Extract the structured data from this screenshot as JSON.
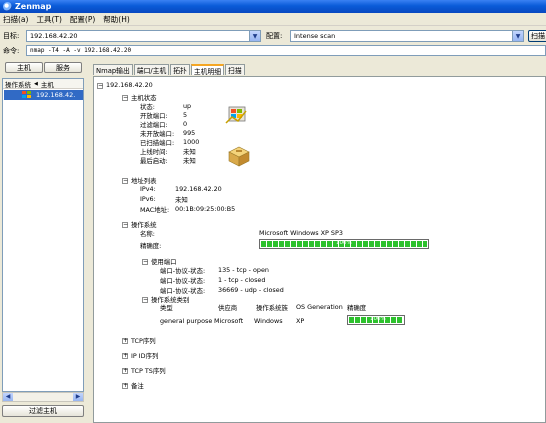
{
  "window": {
    "title": "Zenmap"
  },
  "menu": [
    "扫描(a)",
    "工具(T)",
    "配置(P)",
    "帮助(H)"
  ],
  "toolbar": {
    "target_label": "目标:",
    "target_value": "192.168.42.20",
    "profile_label": "配置:",
    "profile_value": "Intense scan",
    "scan_button": "扫描",
    "command_label": "命令:",
    "command_value": "nmap -T4 -A -v 192.168.42.20"
  },
  "left": {
    "tab_hosts": "主机",
    "tab_services": "服务",
    "col_os": "操作系统",
    "col_host": "主机",
    "host_row": "192.168.42.",
    "filter_button": "过滤主机"
  },
  "tabs": [
    "Nmap输出",
    "端口/主机",
    "拓扑",
    "主机明细",
    "扫描"
  ],
  "details": {
    "host_ip": "192.168.42.20",
    "host_status": {
      "title": "主机状态",
      "fields": [
        {
          "label": "状态:",
          "value": "up"
        },
        {
          "label": "开放端口:",
          "value": "5"
        },
        {
          "label": "过滤端口:",
          "value": "0"
        },
        {
          "label": "未开放端口:",
          "value": "995"
        },
        {
          "label": "已扫描端口:",
          "value": "1000"
        },
        {
          "label": "上线时间:",
          "value": "未知"
        },
        {
          "label": "最后启动:",
          "value": "未知"
        }
      ]
    },
    "addresses": {
      "title": "地址列表",
      "fields": [
        {
          "label": "IPv4:",
          "value": "192.168.42.20"
        },
        {
          "label": "IPv6:",
          "value": "未知"
        },
        {
          "label": "MAC地址:",
          "value": "00:1B:09:25:00:B5"
        }
      ]
    },
    "os": {
      "title": "操作系统",
      "name_label": "名称:",
      "name_value": "Microsoft Windows XP SP3",
      "accuracy_label": "精确度:",
      "accuracy_value": "100%",
      "ports_used": {
        "title": "使用端口",
        "rows": [
          {
            "label": "端口-协议-状态:",
            "value": "135 - tcp - open"
          },
          {
            "label": "端口-协议-状态:",
            "value": "1 - tcp - closed"
          },
          {
            "label": "端口-协议-状态:",
            "value": "36669 - udp - closed"
          }
        ]
      },
      "os_class": {
        "title": "操作系统类别",
        "headers": [
          "类型",
          "供应商",
          "操作系统族",
          "OS Generation",
          "精确度"
        ],
        "row": [
          "general purpose",
          "Microsoft",
          "Windows",
          "XP"
        ],
        "accuracy_value": "100%"
      }
    },
    "collapsed_sections": [
      "TCP序列",
      "IP ID序列",
      "TCP TS序列",
      "备注"
    ]
  }
}
